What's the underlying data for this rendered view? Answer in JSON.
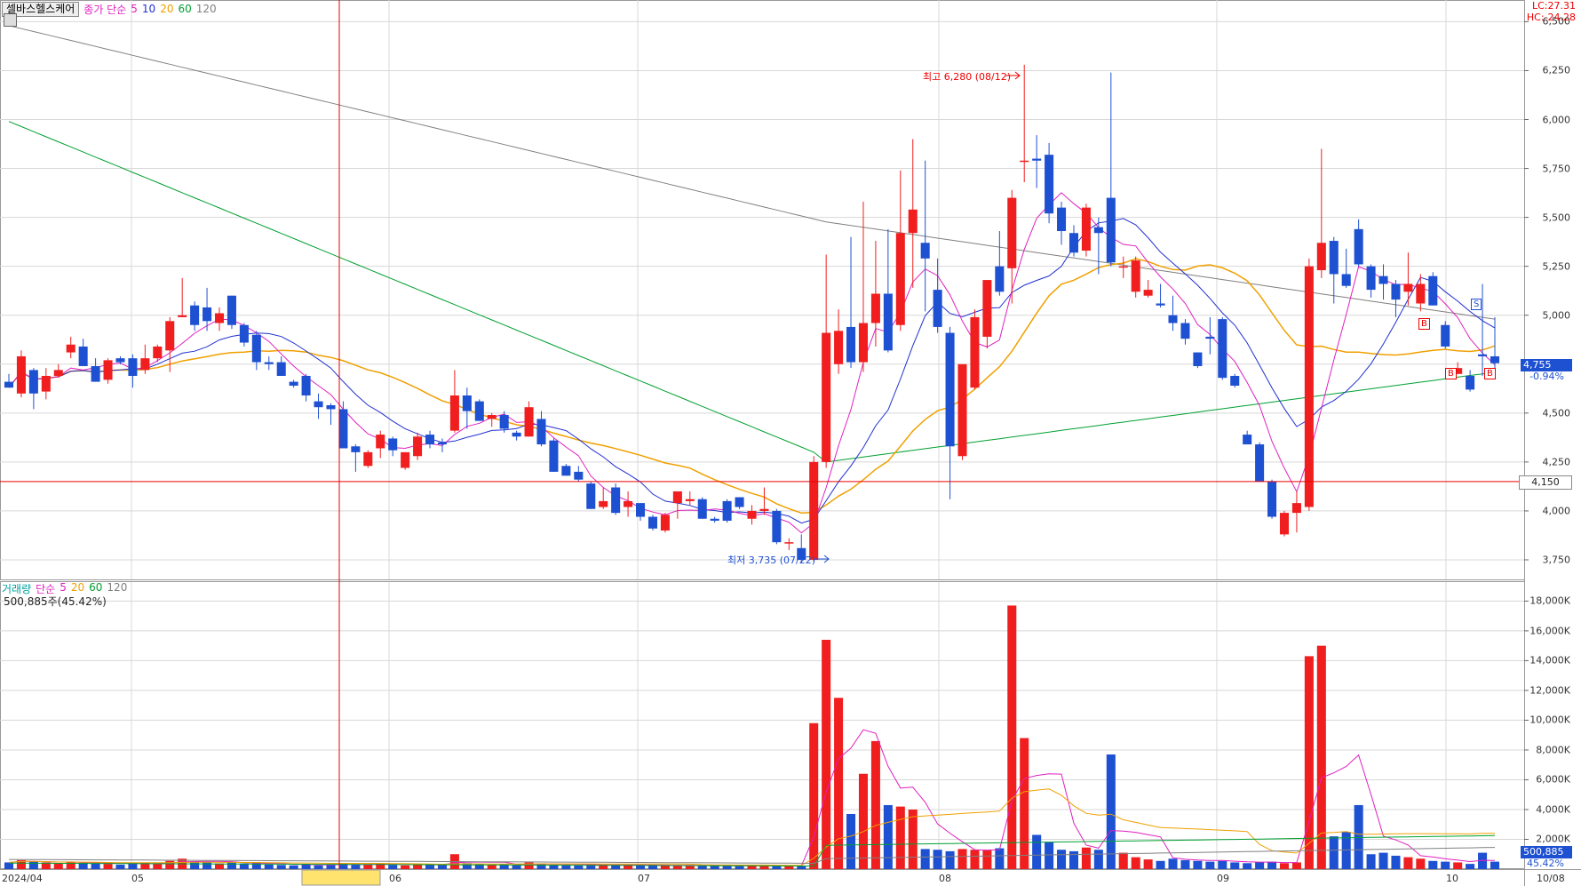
{
  "header": {
    "stock_name": "셀바스헬스케어",
    "ma_label": "종가 단순",
    "ma_periods": [
      "5",
      "10",
      "20",
      "60",
      "120"
    ],
    "ma_colors": [
      "#e020c0",
      "#2030d0",
      "#f0a000",
      "#00a030",
      "#808080"
    ],
    "lc": "LC:27.31",
    "hc": "HC:-24.28"
  },
  "volume_header": {
    "label": "거래량",
    "ma_label": "단순",
    "ma_periods": [
      "5",
      "20",
      "60",
      "120"
    ],
    "ma_colors": [
      "#e020c0",
      "#f0a000",
      "#00a030",
      "#808080"
    ],
    "info": "500,885주(45.42%)"
  },
  "annotations": {
    "high": "최고 6,280 (08/12)",
    "low": "최저 3,735 (07/22)",
    "current_price": "4,755",
    "current_change": "-0.94%",
    "crosshair_price": "4,150",
    "volume_current": "500,885",
    "volume_pct": "45.42%",
    "signal_s": "S",
    "signal_b": "B"
  },
  "axes": {
    "price_ticks": [
      "6,500",
      "6,250",
      "6,000",
      "5,750",
      "5,500",
      "5,250",
      "5,000",
      "4,750",
      "4,500",
      "4,250",
      "4,000",
      "3,750"
    ],
    "volume_ticks": [
      "18,000K",
      "16,000K",
      "14,000K",
      "12,000K",
      "10,000K",
      "8,000K",
      "6,000K",
      "4,000K",
      "2,000K"
    ],
    "x_labels": [
      "2024/04",
      "05",
      "06",
      "07",
      "08",
      "09",
      "10",
      "10/08"
    ]
  },
  "colors": {
    "up": "#f01e1e",
    "down": "#1e50d2",
    "grid": "#d8d8d8",
    "axis_text": "#333333"
  },
  "chart_data": {
    "type": "candlestick",
    "ylim": [
      3650,
      6520
    ],
    "volume_ylim": [
      0,
      18500
    ],
    "volume_unit": "K",
    "candles": [
      {
        "o": 4660,
        "h": 4700,
        "l": 4640,
        "c": 4630,
        "v": 450
      },
      {
        "o": 4600,
        "h": 4820,
        "l": 4580,
        "c": 4790,
        "v": 600
      },
      {
        "o": 4720,
        "h": 4730,
        "l": 4520,
        "c": 4600,
        "v": 500
      },
      {
        "o": 4610,
        "h": 4730,
        "l": 4570,
        "c": 4690,
        "v": 450
      },
      {
        "o": 4690,
        "h": 4750,
        "l": 4680,
        "c": 4720,
        "v": 380
      },
      {
        "o": 4810,
        "h": 4890,
        "l": 4780,
        "c": 4850,
        "v": 500
      },
      {
        "o": 4840,
        "h": 4880,
        "l": 4750,
        "c": 4740,
        "v": 420
      },
      {
        "o": 4740,
        "h": 4780,
        "l": 4660,
        "c": 4660,
        "v": 400
      },
      {
        "o": 4670,
        "h": 4780,
        "l": 4650,
        "c": 4770,
        "v": 350
      },
      {
        "o": 4780,
        "h": 4790,
        "l": 4750,
        "c": 4760,
        "v": 300
      },
      {
        "o": 4780,
        "h": 4800,
        "l": 4630,
        "c": 4690,
        "v": 400
      },
      {
        "o": 4720,
        "h": 4850,
        "l": 4700,
        "c": 4780,
        "v": 420
      },
      {
        "o": 4780,
        "h": 4850,
        "l": 4760,
        "c": 4840,
        "v": 380
      },
      {
        "o": 4820,
        "h": 4990,
        "l": 4710,
        "c": 4970,
        "v": 550
      },
      {
        "o": 4990,
        "h": 5190,
        "l": 4990,
        "c": 5000,
        "v": 700
      },
      {
        "o": 5050,
        "h": 5070,
        "l": 4920,
        "c": 4950,
        "v": 500
      },
      {
        "o": 5040,
        "h": 5140,
        "l": 4920,
        "c": 4970,
        "v": 480
      },
      {
        "o": 4960,
        "h": 5040,
        "l": 4920,
        "c": 5010,
        "v": 380
      },
      {
        "o": 5100,
        "h": 5100,
        "l": 4930,
        "c": 4950,
        "v": 450
      },
      {
        "o": 4950,
        "h": 4960,
        "l": 4840,
        "c": 4860,
        "v": 380
      },
      {
        "o": 4900,
        "h": 4920,
        "l": 4720,
        "c": 4760,
        "v": 400
      },
      {
        "o": 4760,
        "h": 4790,
        "l": 4720,
        "c": 4750,
        "v": 300
      },
      {
        "o": 4760,
        "h": 4790,
        "l": 4690,
        "c": 4690,
        "v": 280
      },
      {
        "o": 4660,
        "h": 4670,
        "l": 4630,
        "c": 4640,
        "v": 250
      },
      {
        "o": 4690,
        "h": 4700,
        "l": 4560,
        "c": 4590,
        "v": 350
      },
      {
        "o": 4560,
        "h": 4600,
        "l": 4470,
        "c": 4530,
        "v": 250
      },
      {
        "o": 4540,
        "h": 4550,
        "l": 4440,
        "c": 4520,
        "v": 280
      },
      {
        "o": 4520,
        "h": 4560,
        "l": 4330,
        "c": 4320,
        "v": 380
      },
      {
        "o": 4330,
        "h": 4340,
        "l": 4200,
        "c": 4300,
        "v": 320
      },
      {
        "o": 4230,
        "h": 4310,
        "l": 4220,
        "c": 4300,
        "v": 300
      },
      {
        "o": 4320,
        "h": 4410,
        "l": 4270,
        "c": 4390,
        "v": 350
      },
      {
        "o": 4370,
        "h": 4380,
        "l": 4280,
        "c": 4310,
        "v": 280
      },
      {
        "o": 4220,
        "h": 4300,
        "l": 4210,
        "c": 4300,
        "v": 250
      },
      {
        "o": 4280,
        "h": 4400,
        "l": 4260,
        "c": 4380,
        "v": 300
      },
      {
        "o": 4390,
        "h": 4410,
        "l": 4320,
        "c": 4340,
        "v": 320
      },
      {
        "o": 4350,
        "h": 4370,
        "l": 4300,
        "c": 4340,
        "v": 280
      },
      {
        "o": 4410,
        "h": 4720,
        "l": 4400,
        "c": 4590,
        "v": 1000
      },
      {
        "o": 4590,
        "h": 4630,
        "l": 4420,
        "c": 4510,
        "v": 400
      },
      {
        "o": 4560,
        "h": 4570,
        "l": 4460,
        "c": 4460,
        "v": 350
      },
      {
        "o": 4470,
        "h": 4500,
        "l": 4430,
        "c": 4490,
        "v": 300
      },
      {
        "o": 4490,
        "h": 4510,
        "l": 4400,
        "c": 4420,
        "v": 320
      },
      {
        "o": 4400,
        "h": 4410,
        "l": 4360,
        "c": 4380,
        "v": 260
      },
      {
        "o": 4380,
        "h": 4560,
        "l": 4380,
        "c": 4530,
        "v": 450
      },
      {
        "o": 4470,
        "h": 4510,
        "l": 4330,
        "c": 4340,
        "v": 380
      },
      {
        "o": 4360,
        "h": 4370,
        "l": 4200,
        "c": 4200,
        "v": 300
      },
      {
        "o": 4230,
        "h": 4240,
        "l": 4180,
        "c": 4180,
        "v": 280
      },
      {
        "o": 4200,
        "h": 4230,
        "l": 4150,
        "c": 4160,
        "v": 250
      },
      {
        "o": 4140,
        "h": 4150,
        "l": 4010,
        "c": 4010,
        "v": 320
      },
      {
        "o": 4020,
        "h": 4120,
        "l": 4010,
        "c": 4050,
        "v": 280
      },
      {
        "o": 4120,
        "h": 4140,
        "l": 3980,
        "c": 3990,
        "v": 300
      },
      {
        "o": 4020,
        "h": 4100,
        "l": 3970,
        "c": 4050,
        "v": 260
      },
      {
        "o": 4040,
        "h": 4040,
        "l": 3950,
        "c": 3970,
        "v": 250
      },
      {
        "o": 3970,
        "h": 3980,
        "l": 3900,
        "c": 3910,
        "v": 270
      },
      {
        "o": 3900,
        "h": 3990,
        "l": 3890,
        "c": 3980,
        "v": 240
      },
      {
        "o": 4040,
        "h": 4090,
        "l": 3960,
        "c": 4100,
        "v": 260
      },
      {
        "o": 4050,
        "h": 4100,
        "l": 4030,
        "c": 4060,
        "v": 220
      },
      {
        "o": 4060,
        "h": 4070,
        "l": 3960,
        "c": 3960,
        "v": 240
      },
      {
        "o": 3960,
        "h": 3970,
        "l": 3940,
        "c": 3950,
        "v": 220
      },
      {
        "o": 4050,
        "h": 4060,
        "l": 3940,
        "c": 3950,
        "v": 230
      },
      {
        "o": 4070,
        "h": 4070,
        "l": 4010,
        "c": 4020,
        "v": 220
      },
      {
        "o": 3960,
        "h": 4030,
        "l": 3930,
        "c": 4000,
        "v": 240
      },
      {
        "o": 4000,
        "h": 4120,
        "l": 3980,
        "c": 4010,
        "v": 230
      },
      {
        "o": 4000,
        "h": 4010,
        "l": 3830,
        "c": 3840,
        "v": 250
      },
      {
        "o": 3840,
        "h": 3860,
        "l": 3800,
        "c": 3840,
        "v": 200
      },
      {
        "o": 3810,
        "h": 3880,
        "l": 3735,
        "c": 3750,
        "v": 220
      },
      {
        "o": 3750,
        "h": 4280,
        "l": 3740,
        "c": 4250,
        "v": 9800
      },
      {
        "o": 4250,
        "h": 5310,
        "l": 4220,
        "c": 4910,
        "v": 15400
      },
      {
        "o": 4750,
        "h": 5030,
        "l": 4700,
        "c": 4920,
        "v": 11500
      },
      {
        "o": 4940,
        "h": 5400,
        "l": 4730,
        "c": 4760,
        "v": 3700
      },
      {
        "o": 4760,
        "h": 5580,
        "l": 4710,
        "c": 4960,
        "v": 6400
      },
      {
        "o": 4960,
        "h": 5380,
        "l": 4840,
        "c": 5110,
        "v": 8600
      },
      {
        "o": 5110,
        "h": 5440,
        "l": 4810,
        "c": 4820,
        "v": 4300
      },
      {
        "o": 4950,
        "h": 5740,
        "l": 4920,
        "c": 5420,
        "v": 4200
      },
      {
        "o": 5420,
        "h": 5900,
        "l": 5140,
        "c": 5540,
        "v": 4000
      },
      {
        "o": 5370,
        "h": 5790,
        "l": 5020,
        "c": 5290,
        "v": 1350
      },
      {
        "o": 5130,
        "h": 5290,
        "l": 4910,
        "c": 4940,
        "v": 1300
      },
      {
        "o": 4910,
        "h": 4940,
        "l": 4060,
        "c": 4330,
        "v": 1200
      },
      {
        "o": 4280,
        "h": 4720,
        "l": 4260,
        "c": 4750,
        "v": 1350
      },
      {
        "o": 4630,
        "h": 5030,
        "l": 4620,
        "c": 4990,
        "v": 1300
      },
      {
        "o": 4890,
        "h": 5180,
        "l": 4830,
        "c": 5180,
        "v": 1250
      },
      {
        "o": 5250,
        "h": 5430,
        "l": 5100,
        "c": 5120,
        "v": 1400
      },
      {
        "o": 5240,
        "h": 5640,
        "l": 5060,
        "c": 5600,
        "v": 17700
      },
      {
        "o": 5790,
        "h": 6280,
        "l": 5680,
        "c": 5790,
        "v": 8800
      },
      {
        "o": 5800,
        "h": 5920,
        "l": 5650,
        "c": 5790,
        "v": 2300
      },
      {
        "o": 5820,
        "h": 5880,
        "l": 5470,
        "c": 5520,
        "v": 1800
      },
      {
        "o": 5550,
        "h": 5580,
        "l": 5360,
        "c": 5430,
        "v": 1300
      },
      {
        "o": 5420,
        "h": 5460,
        "l": 5300,
        "c": 5320,
        "v": 1200
      },
      {
        "o": 5330,
        "h": 5570,
        "l": 5300,
        "c": 5550,
        "v": 1450
      },
      {
        "o": 5450,
        "h": 5500,
        "l": 5210,
        "c": 5420,
        "v": 1300
      },
      {
        "o": 5600,
        "h": 6240,
        "l": 5250,
        "c": 5270,
        "v": 7700
      },
      {
        "o": 5250,
        "h": 5300,
        "l": 5190,
        "c": 5250,
        "v": 1100
      },
      {
        "o": 5120,
        "h": 5300,
        "l": 5090,
        "c": 5280,
        "v": 800
      },
      {
        "o": 5100,
        "h": 5180,
        "l": 5090,
        "c": 5130,
        "v": 650
      },
      {
        "o": 5060,
        "h": 5160,
        "l": 5040,
        "c": 5050,
        "v": 550
      },
      {
        "o": 5000,
        "h": 5100,
        "l": 4920,
        "c": 4960,
        "v": 700
      },
      {
        "o": 4960,
        "h": 4980,
        "l": 4850,
        "c": 4880,
        "v": 600
      },
      {
        "o": 4810,
        "h": 4810,
        "l": 4730,
        "c": 4740,
        "v": 550
      },
      {
        "o": 4890,
        "h": 4990,
        "l": 4800,
        "c": 4880,
        "v": 500
      },
      {
        "o": 4980,
        "h": 4990,
        "l": 4670,
        "c": 4680,
        "v": 550
      },
      {
        "o": 4690,
        "h": 4700,
        "l": 4630,
        "c": 4640,
        "v": 450
      },
      {
        "o": 4390,
        "h": 4410,
        "l": 4340,
        "c": 4340,
        "v": 400
      },
      {
        "o": 4340,
        "h": 4350,
        "l": 4150,
        "c": 4150,
        "v": 450
      },
      {
        "o": 4150,
        "h": 4160,
        "l": 3960,
        "c": 3970,
        "v": 500
      },
      {
        "o": 3880,
        "h": 4000,
        "l": 3870,
        "c": 3990,
        "v": 400
      },
      {
        "o": 3990,
        "h": 4100,
        "l": 3890,
        "c": 4040,
        "v": 450
      },
      {
        "o": 4020,
        "h": 5290,
        "l": 4000,
        "c": 5250,
        "v": 14300
      },
      {
        "o": 5230,
        "h": 5850,
        "l": 5190,
        "c": 5370,
        "v": 15000
      },
      {
        "o": 5380,
        "h": 5400,
        "l": 5060,
        "c": 5210,
        "v": 2200
      },
      {
        "o": 5210,
        "h": 5340,
        "l": 5140,
        "c": 5150,
        "v": 2500
      },
      {
        "o": 5440,
        "h": 5490,
        "l": 5250,
        "c": 5260,
        "v": 4300
      },
      {
        "o": 5250,
        "h": 5260,
        "l": 5090,
        "c": 5130,
        "v": 1000
      },
      {
        "o": 5200,
        "h": 5260,
        "l": 5080,
        "c": 5160,
        "v": 1100
      },
      {
        "o": 5160,
        "h": 5180,
        "l": 4990,
        "c": 5080,
        "v": 900
      },
      {
        "o": 5120,
        "h": 5320,
        "l": 5050,
        "c": 5160,
        "v": 800
      },
      {
        "o": 5060,
        "h": 5210,
        "l": 5020,
        "c": 5160,
        "v": 700
      },
      {
        "o": 5200,
        "h": 5220,
        "l": 5050,
        "c": 5050,
        "v": 550
      },
      {
        "o": 4950,
        "h": 4970,
        "l": 4830,
        "c": 4840,
        "v": 500
      },
      {
        "o": 4700,
        "h": 4760,
        "l": 4700,
        "c": 4730,
        "v": 450
      },
      {
        "o": 4690,
        "h": 4720,
        "l": 4610,
        "c": 4620,
        "v": 350
      },
      {
        "o": 4800,
        "h": 5160,
        "l": 4690,
        "c": 4790,
        "v": 1100
      },
      {
        "o": 4790,
        "h": 4990,
        "l": 4720,
        "c": 4755,
        "v": 501
      }
    ]
  }
}
